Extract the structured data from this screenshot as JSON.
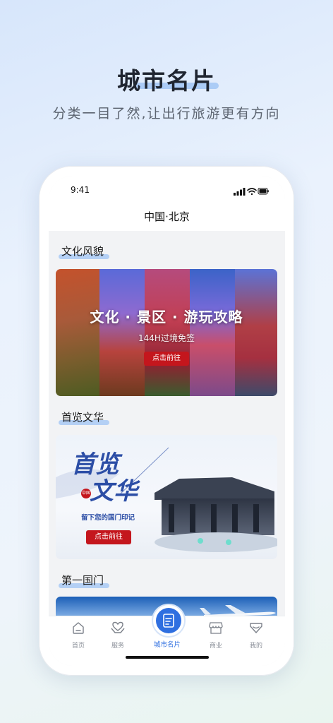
{
  "promo": {
    "title": "城市名片",
    "subtitle": "分类一目了然,让出行旅游更有方向"
  },
  "status_bar": {
    "time": "9:41"
  },
  "nav": {
    "title": "中国·北京"
  },
  "sections": [
    {
      "title": "文化风貌",
      "banner": {
        "title": "文化 · 景区 · 游玩攻略",
        "subtitle": "144H过境免签",
        "button": "点击前往"
      }
    },
    {
      "title": "首览文华",
      "banner": {
        "title_line1": "首览",
        "title_line2": "文华",
        "seal": "中国",
        "subtitle": "留下您的国门印记",
        "button": "点击前往"
      }
    },
    {
      "title": "第一国门"
    }
  ],
  "tabbar": {
    "items": [
      {
        "label": "首页",
        "icon": "home-icon"
      },
      {
        "label": "服务",
        "icon": "heart-hands-icon"
      },
      {
        "label": "城市名片",
        "icon": "city-card-icon",
        "active": true
      },
      {
        "label": "商业",
        "icon": "shop-icon"
      },
      {
        "label": "我的",
        "icon": "profile-diamond-icon"
      }
    ]
  },
  "colors": {
    "accent": "#2f6fe0",
    "button_red": "#c4161d",
    "section_underline": "#a9c9f4"
  }
}
